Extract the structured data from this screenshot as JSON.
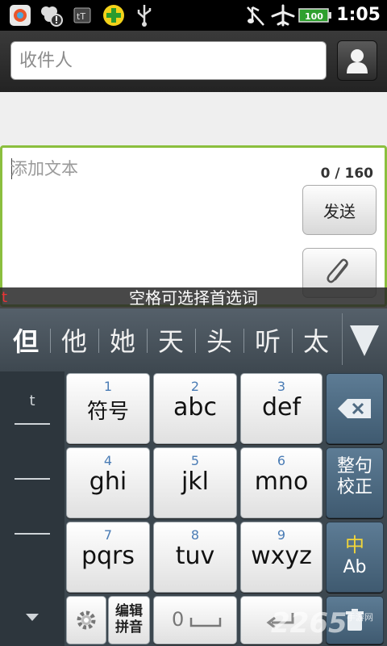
{
  "status_bar": {
    "time": "1:05",
    "battery": "100",
    "left_icons": [
      "app-store-icon",
      "clover-alert-icon",
      "tt-icon",
      "plus-green-icon",
      "usb-icon"
    ],
    "right_icons": [
      "mute-icon",
      "airplane-icon",
      "battery-icon"
    ]
  },
  "recipient": {
    "placeholder": "收件人",
    "value": ""
  },
  "compose": {
    "placeholder": "添加文本",
    "counter": "0 / 160",
    "send_label": "发送"
  },
  "ime": {
    "hint": "空格可选择首选词",
    "typed": "t",
    "candidates": [
      "但",
      "他",
      "她",
      "天",
      "头",
      "听",
      "太"
    ]
  },
  "keyboard": {
    "side_items": [
      "t",
      "",
      "",
      ""
    ],
    "keys": [
      {
        "num": "1",
        "label": "符号"
      },
      {
        "num": "2",
        "label": "abc"
      },
      {
        "num": "3",
        "label": "def"
      },
      {
        "num": "4",
        "label": "ghi"
      },
      {
        "num": "5",
        "label": "jkl"
      },
      {
        "num": "6",
        "label": "mno"
      },
      {
        "num": "7",
        "label": "pqrs"
      },
      {
        "num": "8",
        "label": "tuv"
      },
      {
        "num": "9",
        "label": "wxyz"
      }
    ],
    "correct_label_1": "整句",
    "correct_label_2": "校正",
    "lang_top": "中",
    "lang_bottom": "Ab",
    "edit_label_1": "编辑",
    "edit_label_2": "拼音",
    "zero_label": "0"
  },
  "watermark": {
    "main": "2265",
    "sub": "手游网"
  }
}
